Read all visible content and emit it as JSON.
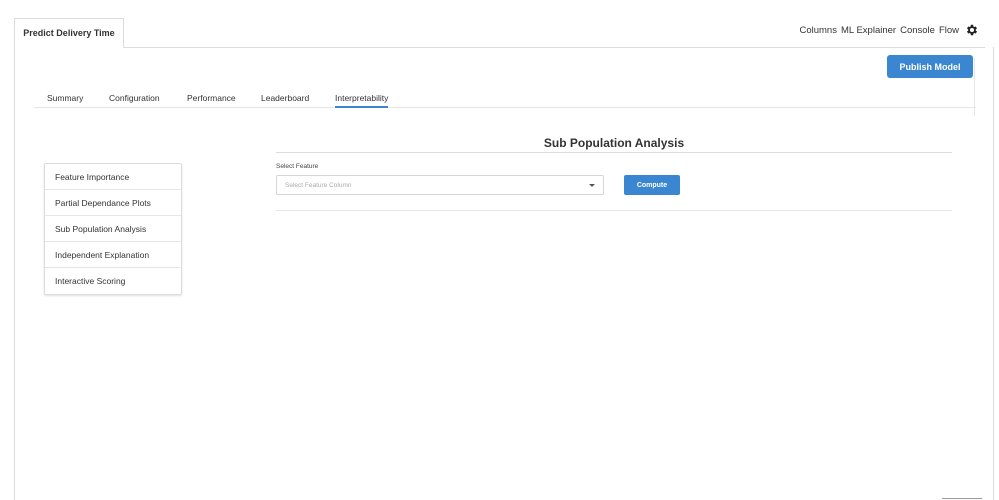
{
  "document_tab": {
    "label": "Predict Delivery Time"
  },
  "top_nav": {
    "items": [
      "Columns",
      "ML Explainer",
      "Console",
      "Flow"
    ],
    "settings_icon": "gear-icon"
  },
  "toolbar": {
    "publish_label": "Publish Model"
  },
  "subtabs": {
    "items": [
      "Summary",
      "Configuration",
      "Performance",
      "Leaderboard",
      "Interpretability"
    ],
    "active": "Interpretability"
  },
  "sidebar": {
    "items": [
      {
        "label": "Feature Importance"
      },
      {
        "label": "Partial Dependance Plots"
      },
      {
        "label": "Sub Population Analysis"
      },
      {
        "label": "Independent Explanation"
      },
      {
        "label": "Interactive Scoring"
      }
    ]
  },
  "panel": {
    "title": "Sub Population Analysis",
    "select_label": "Select Feature",
    "select_placeholder": "Select Feature Column",
    "compute_label": "Compute"
  },
  "colors": {
    "accent": "#3a86d0",
    "border": "#dcdcdc"
  }
}
